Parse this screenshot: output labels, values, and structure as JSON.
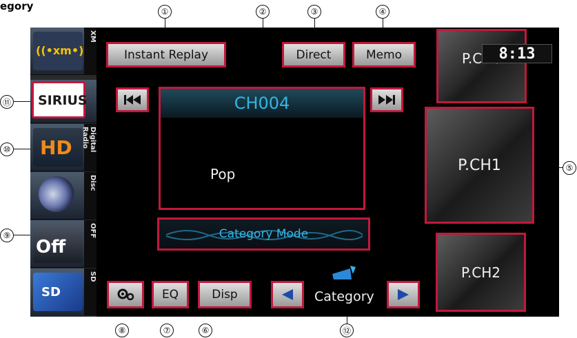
{
  "fragment_title": "egory",
  "sources": {
    "xm_label": "XM",
    "sirius_text": "SIRIUS",
    "digital_label": "Digital Radio",
    "disc_label": "Disc",
    "off_label": "OFF",
    "off_text": "Off",
    "sd_label": "SD"
  },
  "top_buttons": {
    "instant_replay": "Instant Replay",
    "direct": "Direct",
    "memo": "Memo"
  },
  "clock": "8:13",
  "channel": {
    "name": "CH004",
    "category": "Pop"
  },
  "category_mode": "Category Mode",
  "presets": {
    "p0": "P.CH0",
    "p1": "P.CH1",
    "p2": "P.CH2"
  },
  "bottom_buttons": {
    "eq": "EQ",
    "disp": "Disp",
    "category": "Category"
  },
  "callouts": [
    "①",
    "②",
    "③",
    "④",
    "⑤",
    "⑥",
    "⑦",
    "⑧",
    "⑨",
    "⑩",
    "⑪",
    "⑫"
  ],
  "colors": {
    "accent_frame": "#c2183d",
    "channel_text": "#33b6e6",
    "category_mode_text": "#33b6e6"
  }
}
